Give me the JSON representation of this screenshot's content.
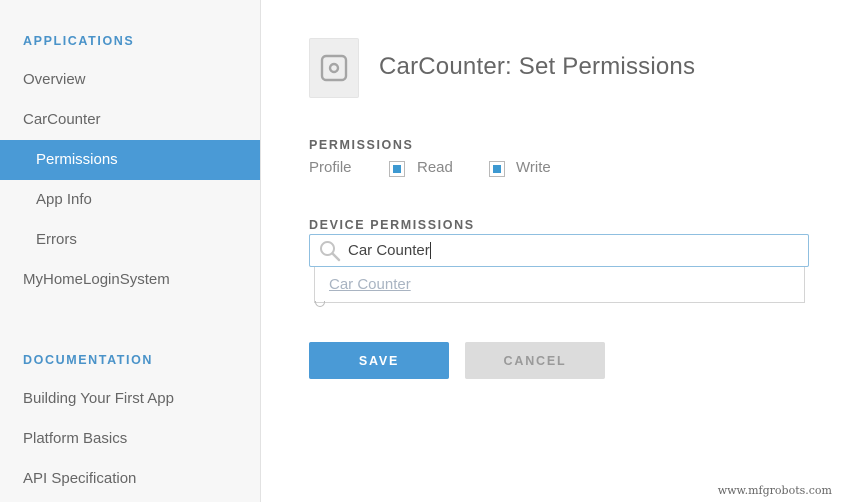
{
  "sidebar": {
    "applications_heading": "APPLICATIONS",
    "applications": [
      {
        "label": "Overview"
      },
      {
        "label": "CarCounter"
      },
      {
        "label": "Permissions",
        "active": true
      },
      {
        "label": "App Info"
      },
      {
        "label": "Errors"
      },
      {
        "label": "MyHomeLoginSystem"
      }
    ],
    "documentation_heading": "DOCUMENTATION",
    "documentation": [
      {
        "label": "Building Your First App"
      },
      {
        "label": "Platform Basics"
      },
      {
        "label": "API Specification"
      }
    ]
  },
  "main": {
    "app_icon": "app-placeholder-icon",
    "title": "CarCounter: Set Permissions",
    "permissions_heading": "PERMISSIONS",
    "profile_label": "Profile",
    "read_label": "Read",
    "read_checked": true,
    "write_label": "Write",
    "write_checked": true,
    "device_permissions_heading": "DEVICE PERMISSIONS",
    "search_value": "Car Counter",
    "suggestion": "Car Counter",
    "save_label": "SAVE",
    "cancel_label": "CANCEL"
  },
  "watermark": "www.mfgrobots.com",
  "colors": {
    "accent": "#4a9ad6",
    "heading_blue": "#4a93c9",
    "cancel_bg": "#dcdcdc"
  }
}
